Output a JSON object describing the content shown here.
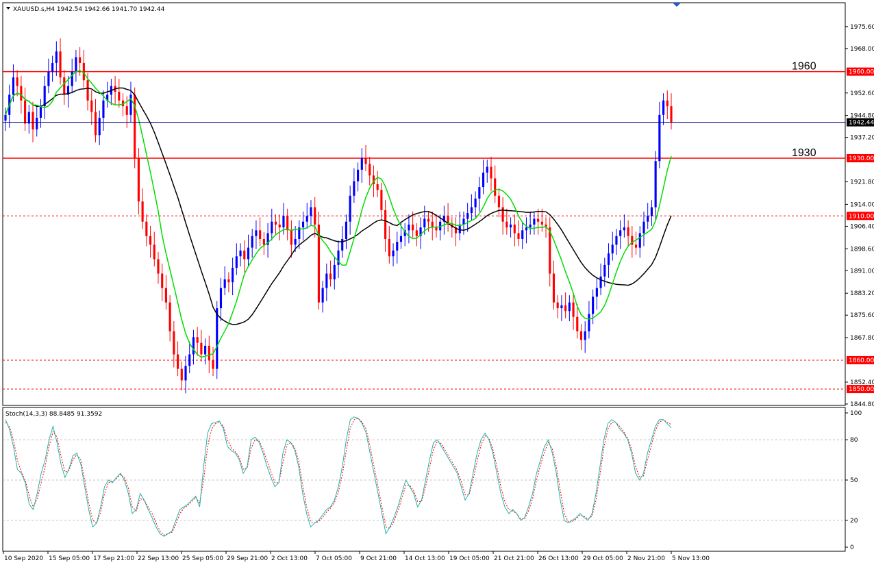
{
  "header": {
    "main_label": "XAUUSD.s,H4  1942.54 1942.66 1941.70 1942.44",
    "sub_label": "Stoch(14,3,3) 88.8485 91.3592"
  },
  "colors": {
    "bull": "#0000ff",
    "bear": "#ff0000",
    "ma_fast": "#00dd00",
    "ma_slow": "#000000",
    "level": "#ff0000",
    "bid": "#000080",
    "stoch_main": "#20b2aa",
    "stoch_signal": "#ff0000",
    "grid": "#c0c0c0"
  },
  "chart_data": [
    {
      "type": "candlestick",
      "symbol": "XAUUSD.s",
      "timeframe": "H4",
      "ylim": [
        1844.8,
        1983.4
      ],
      "y_ticks": [
        "1975.60",
        "1968.00",
        "1952.60",
        "1944.80",
        "1937.20",
        "1921.80",
        "1914.00",
        "1906.40",
        "1898.60",
        "1891.00",
        "1883.20",
        "1875.60",
        "1867.80",
        "1852.40",
        "1844.80"
      ],
      "x_ticks": [
        "10 Sep 2020",
        "15 Sep 05:00",
        "17 Sep 21:00",
        "22 Sep 13:00",
        "25 Sep 05:00",
        "29 Sep 21:00",
        "2 Oct 13:00",
        "7 Oct 05:00",
        "9 Oct 21:00",
        "14 Oct 13:00",
        "19 Oct 05:00",
        "21 Oct 21:00",
        "26 Oct 13:00",
        "29 Oct 05:00",
        "2 Nov 21:00",
        "5 Nov 13:00"
      ],
      "bid": {
        "value": 1942.44,
        "label": "1942.44"
      },
      "levels": [
        {
          "value": 1960.0,
          "tag": "1960.00",
          "style": "solid",
          "text": "1960"
        },
        {
          "value": 1930.0,
          "tag": "1930.00",
          "style": "solid",
          "text": "1930"
        },
        {
          "value": 1910.0,
          "tag": "1910.00",
          "style": "dashed"
        },
        {
          "value": 1860.0,
          "tag": "1860.00",
          "style": "dashed"
        },
        {
          "value": 1850.0,
          "tag": "1850.00",
          "style": "dashed"
        }
      ],
      "close": [
        1945,
        1952,
        1958,
        1955,
        1950,
        1942,
        1946,
        1940,
        1944,
        1948,
        1955,
        1960,
        1963,
        1967,
        1958,
        1952,
        1955,
        1960,
        1965,
        1963,
        1957,
        1950,
        1946,
        1938,
        1944,
        1950,
        1952,
        1955,
        1953,
        1950,
        1948,
        1945,
        1952,
        1930,
        1915,
        1908,
        1903,
        1900,
        1895,
        1890,
        1885,
        1880,
        1870,
        1862,
        1857,
        1853,
        1858,
        1862,
        1868,
        1866,
        1862,
        1865,
        1860,
        1857,
        1878,
        1885,
        1888,
        1887,
        1892,
        1896,
        1898,
        1895,
        1899,
        1903,
        1905,
        1902,
        1900,
        1904,
        1908,
        1907,
        1906,
        1910,
        1905,
        1900,
        1902,
        1906,
        1908,
        1910,
        1913,
        1907,
        1880,
        1885,
        1890,
        1888,
        1893,
        1898,
        1902,
        1908,
        1917,
        1922,
        1926,
        1930,
        1928,
        1924,
        1921,
        1919,
        1912,
        1902,
        1896,
        1898,
        1901,
        1903,
        1905,
        1907,
        1905,
        1903,
        1906,
        1909,
        1908,
        1906,
        1905,
        1908,
        1910,
        1907,
        1906,
        1904,
        1907,
        1909,
        1911,
        1913,
        1916,
        1920,
        1925,
        1927,
        1923,
        1917,
        1913,
        1908,
        1906,
        1907,
        1904,
        1902,
        1905,
        1906,
        1907,
        1909,
        1908,
        1907,
        1906,
        1890,
        1880,
        1878,
        1879,
        1877,
        1880,
        1875,
        1870,
        1867,
        1870,
        1876,
        1882,
        1885,
        1889,
        1893,
        1897,
        1900,
        1903,
        1905,
        1906,
        1903,
        1900,
        1899,
        1904,
        1908,
        1910,
        1913,
        1929,
        1945,
        1950,
        1948,
        1942.44
      ],
      "series": [
        {
          "name": "",
          "kind": "ma-fast"
        },
        {
          "name": "",
          "kind": "ma-slow"
        }
      ]
    },
    {
      "type": "line",
      "name": "Stoch(14,3,3)",
      "ylim": [
        0,
        100
      ],
      "y_ticks": [
        "100",
        "80",
        "50",
        "20",
        "0"
      ],
      "levels": [
        80,
        50,
        20
      ],
      "main": [
        95,
        88,
        75,
        58,
        55,
        48,
        32,
        28,
        40,
        55,
        65,
        80,
        90,
        78,
        62,
        52,
        58,
        68,
        70,
        62,
        45,
        28,
        15,
        18,
        30,
        45,
        50,
        48,
        52,
        55,
        50,
        40,
        25,
        28,
        40,
        35,
        28,
        22,
        15,
        10,
        8,
        10,
        12,
        20,
        28,
        30,
        32,
        35,
        38,
        30,
        60,
        85,
        92,
        93,
        94,
        88,
        75,
        72,
        70,
        65,
        55,
        60,
        80,
        82,
        78,
        70,
        60,
        52,
        45,
        48,
        70,
        80,
        78,
        72,
        60,
        40,
        25,
        15,
        18,
        20,
        24,
        28,
        30,
        35,
        45,
        60,
        80,
        95,
        97,
        96,
        92,
        85,
        70,
        55,
        40,
        25,
        10,
        15,
        22,
        30,
        40,
        50,
        45,
        40,
        30,
        35,
        50,
        65,
        78,
        80,
        75,
        70,
        65,
        60,
        55,
        45,
        35,
        40,
        55,
        70,
        80,
        85,
        80,
        70,
        55,
        40,
        30,
        25,
        28,
        25,
        20,
        22,
        30,
        40,
        55,
        65,
        75,
        80,
        70,
        55,
        35,
        20,
        18,
        20,
        22,
        25,
        22,
        20,
        25,
        40,
        60,
        80,
        92,
        95,
        93,
        88,
        85,
        80,
        70,
        55,
        50,
        55,
        70,
        80,
        90,
        95,
        95,
        92,
        89
      ],
      "signal": [
        93,
        90,
        80,
        65,
        56,
        50,
        38,
        30,
        36,
        48,
        60,
        75,
        86,
        82,
        68,
        56,
        57,
        65,
        69,
        65,
        50,
        33,
        20,
        18,
        26,
        40,
        48,
        49,
        51,
        54,
        52,
        44,
        30,
        27,
        36,
        35,
        30,
        25,
        18,
        12,
        9,
        10,
        11,
        17,
        25,
        29,
        31,
        34,
        37,
        33,
        50,
        75,
        88,
        92,
        93,
        90,
        80,
        74,
        71,
        67,
        58,
        59,
        74,
        80,
        79,
        73,
        64,
        56,
        48,
        48,
        63,
        76,
        78,
        74,
        64,
        46,
        30,
        19,
        18,
        19,
        22,
        26,
        29,
        33,
        41,
        54,
        72,
        89,
        95,
        96,
        93,
        88,
        75,
        60,
        45,
        30,
        15,
        14,
        19,
        27,
        36,
        46,
        46,
        42,
        34,
        34,
        45,
        59,
        73,
        79,
        77,
        72,
        67,
        62,
        57,
        49,
        39,
        39,
        50,
        64,
        76,
        83,
        81,
        73,
        60,
        45,
        34,
        28,
        27,
        25,
        21,
        21,
        27,
        36,
        50,
        61,
        71,
        78,
        73,
        60,
        42,
        25,
        19,
        19,
        21,
        24,
        23,
        21,
        23,
        35,
        54,
        74,
        88,
        93,
        93,
        90,
        86,
        81,
        73,
        60,
        52,
        53,
        65,
        76,
        87,
        93,
        95,
        93,
        91.36
      ]
    }
  ]
}
